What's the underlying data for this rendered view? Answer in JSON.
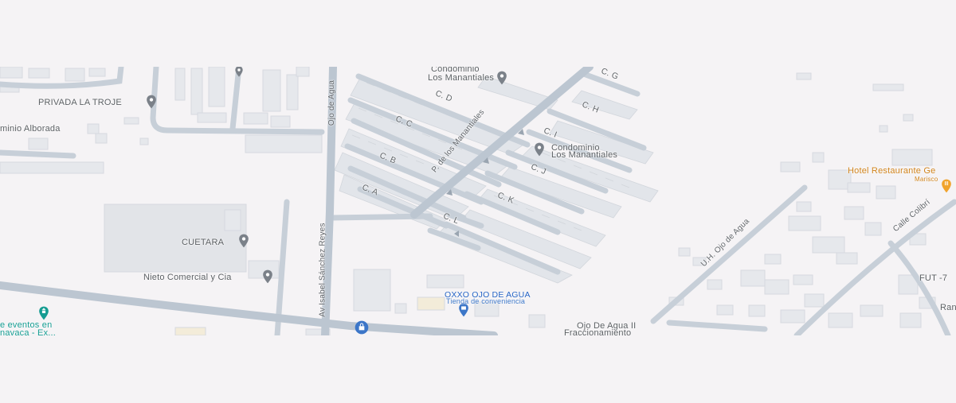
{
  "colors": {
    "background": "#f5f3f5",
    "road": "#c4ccd6",
    "road_major": "#bec8d2",
    "block": "#e4e6ea",
    "block_outline": "#d7dae0",
    "poi_gray": "#7b8189",
    "poi_teal": "#159c92",
    "poi_orange": "#f0a32c",
    "poi_blue": "#3c76c8"
  },
  "places": {
    "privada_la_troje": "PRIVADA LA TROJE",
    "alborada": "minio Alborada",
    "condominio_1_line1": "Condominio",
    "condominio_1_line2": "Los Manantiales",
    "condominio_2_line1": "Condominio",
    "condominio_2_line2": "Los Manantiales",
    "cuetara": "CUETARA",
    "nieto": "Nieto Comercial y Cia",
    "eventos_line1": "e eventos en",
    "eventos_line2": "navaca - Ex...",
    "oxxo": "OXXO OJO DE AGUA",
    "oxxo_sub": "Tienda de conveniencia",
    "ojo_line1": "Ojo De Agua II",
    "ojo_line2": "Fraccionamiento",
    "hotel": "Hotel Restaurante Ge",
    "hotel_sub": "Marisco",
    "fut": "FUT -7",
    "ran": "Ran"
  },
  "streets": {
    "ojo_de_agua": "Ojo de Agua",
    "isabel": "Av Isabel Sánchez Reyes",
    "manantiales": "P. de los Manantiales",
    "uh_ojo": "U.H. Ojo de Agua",
    "calle_colibri": "Calle Colibrí",
    "c_a": "C. A",
    "c_b": "C. B",
    "c_c": "C. C",
    "c_d": "C. D",
    "c_g": "C. G",
    "c_h": "C. H",
    "c_i": "C. I",
    "c_j": "C. J",
    "c_k": "C. K",
    "c_l": "C. L"
  },
  "icons": [
    "place-pin-icon",
    "event-venue-icon",
    "store-icon",
    "restaurant-icon",
    "shopping-bag-icon"
  ]
}
